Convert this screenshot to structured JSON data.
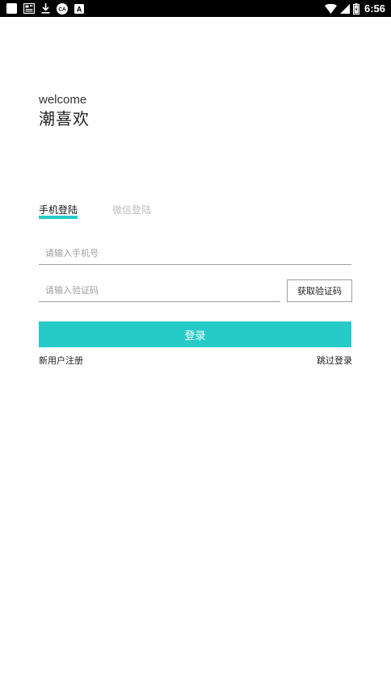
{
  "status_bar": {
    "time": "6:56",
    "left_icons": [
      "notification-square-icon",
      "gallery-icon",
      "download-icon",
      "ca-badge-icon",
      "a-badge-icon"
    ],
    "right_icons": [
      "wifi-icon",
      "cell-signal-icon",
      "battery-icon"
    ]
  },
  "welcome": {
    "greeting": "welcome",
    "app_name": "潮喜欢"
  },
  "tabs": [
    {
      "label": "手机登陆",
      "active": true
    },
    {
      "label": "微信登陆",
      "active": false
    }
  ],
  "form": {
    "phone_placeholder": "请输入手机号",
    "phone_value": "",
    "code_placeholder": "请输入验证码",
    "code_value": "",
    "get_code_label": "获取验证码",
    "login_label": "登录"
  },
  "links": {
    "register": "新用户注册",
    "skip": "跳过登录"
  },
  "colors": {
    "accent": "#26cbc8",
    "status_bar_bg": "#000000",
    "inactive_tab": "#bdbdbd"
  }
}
